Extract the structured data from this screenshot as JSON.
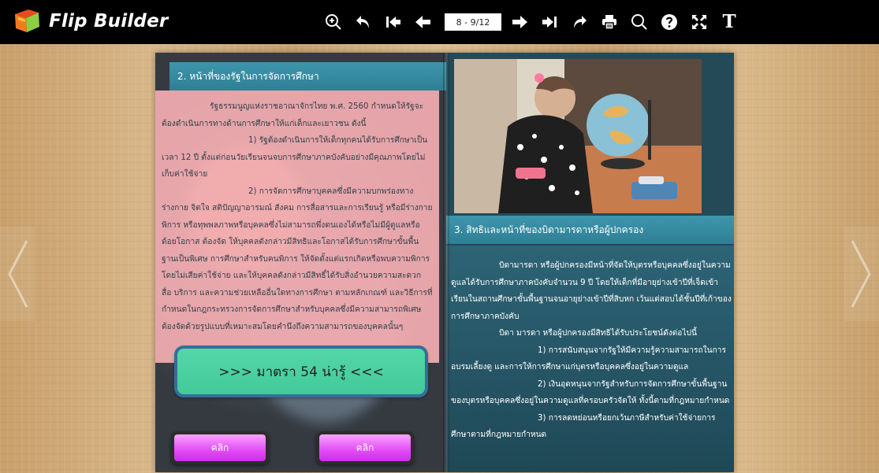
{
  "app": {
    "title": "Flip Builder"
  },
  "toolbar": {
    "tools": [
      "zoom-in-icon",
      "undo-icon",
      "first-page-icon",
      "prev-page-icon"
    ],
    "page_indicator": "8 - 9/12",
    "tools_after": [
      "next-page-icon",
      "last-page-icon",
      "redo-icon",
      "print-icon",
      "search-icon",
      "help-icon",
      "fullscreen-icon"
    ],
    "text_tool": "T"
  },
  "book": {
    "left_page": {
      "heading": "2. หน้าที่ของรัฐในการจัดการศึกษา",
      "paragraphs": [
        "รัฐธรรมนูญแห่งราชอาณาจักรไทย พ.ศ. 2560 กำหนดให้รัฐจะต้องดำเนินการทางด้านการศึกษาให้แก่เด็กและเยาวชน ดังนี้",
        "1) รัฐต้องดำเนินการให้เด็กทุกคนได้รับการศึกษาเป็นเวลา 12 ปี ตั้งแต่ก่อนวัยเรียนจนจบการศึกษาภาคบังคับอย่างมีคุณภาพโดยไม่เก็บค่าใช้จ่าย",
        "2) การจัดการศึกษาบุคคลซึ่งมีความบกพร่องทางร่างกาย จิตใจ สติปัญญาอารมณ์ สังคม การสื่อสารและการเรียนรู้ หรือมีร่างกายพิการ หรือทุพพลภาพหรือบุคคลซึ่งไม่สามารถพึ่งตนเองได้หรือไม่มีผู้ดูแลหรือด้อยโอกาส ต้องจัด ให้บุคคลดังกล่าวมีสิทธิและโอกาสได้รับการศึกษาขั้นพื้นฐานเป็นพิเศษ การศึกษาสำหรับคนพิการ ให้จัดตั้งแต่แรกเกิดหรือพบความพิการโดยไม่เสียค่าใช้จ่าย และให้บุคคลดังกล่าวมีสิทธิ์ได้รับสิ่งอำนวยความสะดวก สื่อ บริการ และความช่วยเหลืออื่นใดทางการศึกษา ตามหลักเกณฑ์ และวิธีการที่กำหนดในกฎกระทรวงการจัดการศึกษาสำหรับบุคคลซึ่งมีความสามารถพิเศษ ต้องจัดด้วยรูปแบบที่เหมาะสมโดยคำนึงถึงความสามารถของบุคคลนั้นๆ"
      ],
      "link_button": ">>> มาตรา 54 น่ารู้ <<<",
      "click_label_1": "คลิก",
      "click_label_2": "คลิก"
    },
    "right_page": {
      "heading": "3. สิทธิและหน้าที่ของบิดามารดาหรือผู้ปกครอง",
      "paragraphs": [
        "บิดามารดา หรือผู้ปกครองมีหน้าที่จัดให้บุตรหรือบุคคลซึ่งอยู่ในความดูแลได้รับการศึกษาภาคบังคับจำนวน 9 ปี โดยให้เด็กที่มีอายุย่างเข้าปีที่เจ็ดเข้าเรียนในสถานศึกษาขั้นพื้นฐานจนอายุย่างเข้าปีที่สิบหก เว้นแต่สอบได้ชั้นปีที่เก้าของการศึกษาภาคบังคับ",
        "บิดา มารดา หรือผู้ปกครองมีสิทธิได้รับประโยชน์ดังต่อไปนี้",
        "1) การสนับสนุนจากรัฐให้มีความรู้ความสามารถในการอบรมเลี้ยงดู และการให้การศึกษาแก่บุตรหรือบุคคลซึ่งอยู่ในความดูแล",
        "2) เงินอุดหนุนจากรัฐสำหรับการจัดการศึกษาขั้นพื้นฐานของบุตรหรือบุคคลซึ่งอยู่ในความดูแลที่ครอบครัวจัดให้ ทั้งนี้ตามที่กฎหมายกำหนด",
        "3) การลดหย่อนหรือยกเว้นภาษีสำหรับค่าใช้จ่ายการศึกษาตามที่กฎหมายกำหนด"
      ]
    }
  },
  "colors": {
    "accent": "#2f7f95",
    "pink": "#f4aeb2",
    "green": "#4bd19f",
    "magenta": "#e24bf5"
  }
}
